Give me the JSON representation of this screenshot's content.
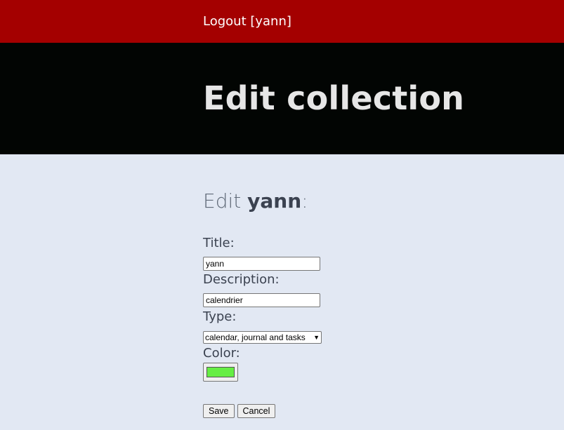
{
  "nav": {
    "logout_label": "Logout [yann]"
  },
  "header": {
    "title": "Edit collection"
  },
  "form": {
    "heading_prefix": "Edit ",
    "heading_name": "yann",
    "heading_suffix": ":",
    "title_label": "Title:",
    "title_value": "yann",
    "description_label": "Description:",
    "description_value": "calendrier",
    "type_label": "Type:",
    "type_selected": "calendar, journal and tasks",
    "color_label": "Color:",
    "color_value": "#66ee44",
    "save_label": "Save",
    "cancel_label": "Cancel"
  },
  "colors": {
    "topbar": "#a40000",
    "header": "#020503",
    "background": "#e2e8f3"
  }
}
